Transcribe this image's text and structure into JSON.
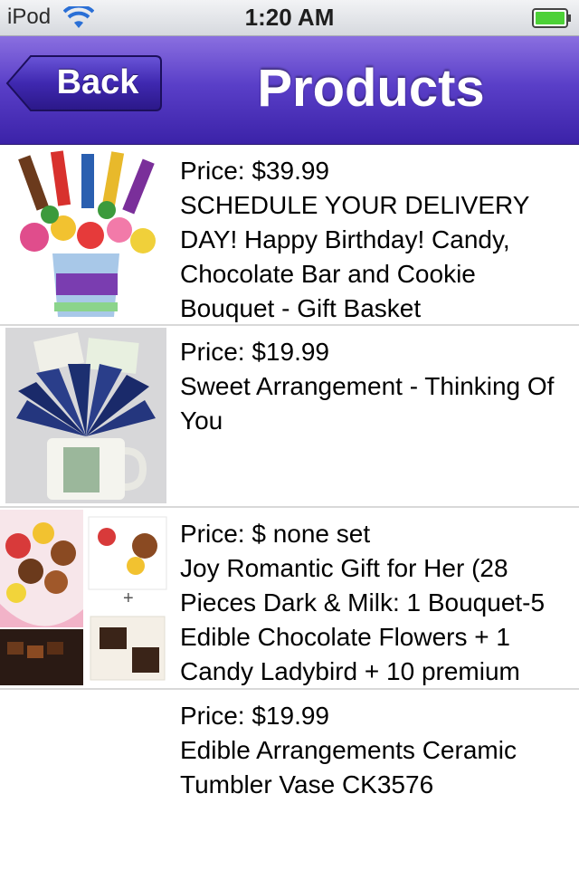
{
  "status_bar": {
    "carrier": "iPod",
    "time": "1:20 AM"
  },
  "nav": {
    "back_label": "Back",
    "title": "Products"
  },
  "products": [
    {
      "price": "Price: $39.99",
      "title": "SCHEDULE YOUR DELIVERY DAY! Happy Birthday! Candy, Chocolate Bar and Cookie Bouquet - Gift Basket"
    },
    {
      "price": "Price: $19.99",
      "title": "Sweet Arrangement - Thinking Of You"
    },
    {
      "price": "Price: $ none set",
      "title": "Joy Romantic Gift for Her (28 Pieces Dark & Milk: 1 Bouquet-5 Edible Chocolate Flowers + 1 Candy Ladybird + 10 premium"
    },
    {
      "price": "Price: $19.99",
      "title": "Edible Arrangements Ceramic Tumbler Vase CK3576"
    }
  ],
  "colors": {
    "nav_top": "#8a6fe0",
    "nav_bottom": "#3b22a8",
    "battery_green": "#4cd137"
  }
}
